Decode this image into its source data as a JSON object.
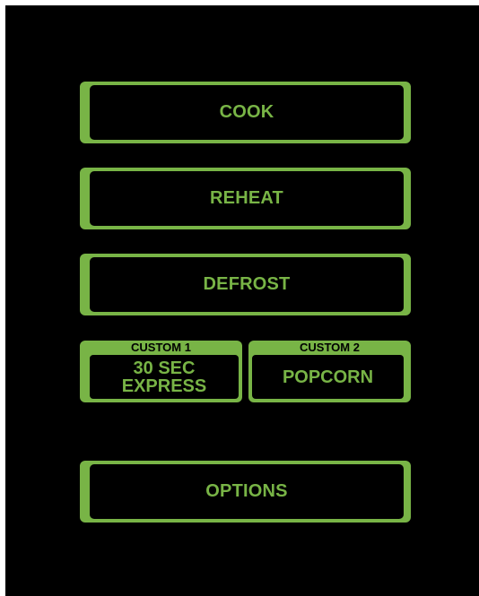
{
  "menu": {
    "cook_label": "COOK",
    "reheat_label": "REHEAT",
    "defrost_label": "DEFROST",
    "options_label": "OPTIONS"
  },
  "custom": {
    "one": {
      "tag": "CUSTOM 1",
      "value": "30 SEC\nEXPRESS"
    },
    "two": {
      "tag": "CUSTOM 2",
      "value": "POPCORN"
    }
  },
  "colors": {
    "accent": "#78b446",
    "background": "#000000"
  }
}
